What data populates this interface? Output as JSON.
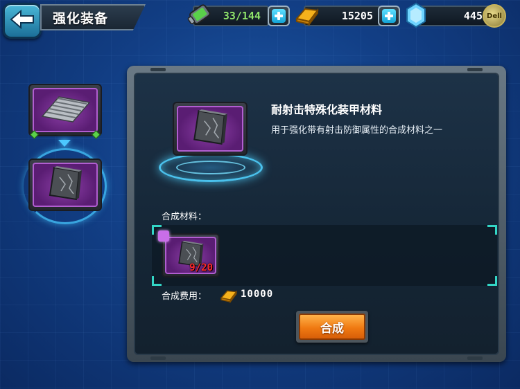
{
  "header": {
    "title": "强化装备",
    "back_icon": "back-arrow-icon"
  },
  "resources": {
    "energy": {
      "value": "33/144",
      "icon": "energy-battery-icon"
    },
    "gold": {
      "value": "15205",
      "icon": "gold-bar-icon"
    },
    "gems": {
      "value": "445",
      "icon": "diamond-icon"
    }
  },
  "avatar": {
    "label": "Dell"
  },
  "sidebar": {
    "items": [
      {
        "icon": "corrugated-plate-icon"
      },
      {
        "icon": "armor-plate-icon",
        "selected": true
      }
    ]
  },
  "detail": {
    "name": "耐射击特殊化装甲材料",
    "description": "用于强化带有射击防御属性的合成材料之一",
    "materials_label": "合成材料：",
    "material": {
      "icon": "armor-plate-icon",
      "count": "9/20"
    },
    "cost_label": "合成费用：",
    "cost_value": "10000",
    "synth_button": "合成"
  },
  "colors": {
    "accent_cyan": "#4cc8ff",
    "rarity_purple": "#8d3fa8",
    "button_orange": "#f07a12",
    "insufficient_red": "#ff2a2a",
    "energy_green": "#8fe36a"
  }
}
